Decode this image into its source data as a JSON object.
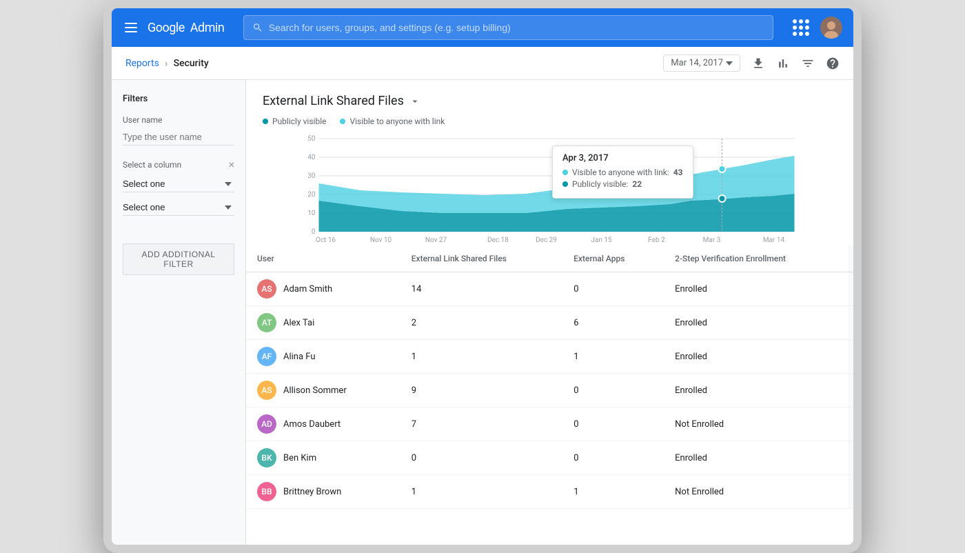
{
  "topbar": {
    "search_placeholder": "Search for users, groups, and settings (e.g. setup billing)",
    "logo_text": "Google",
    "admin_text": "Admin"
  },
  "breadcrumb": {
    "reports": "Reports",
    "security": "Security",
    "date": "Mar 14, 2017"
  },
  "filters": {
    "title": "Filters",
    "username_label": "User name",
    "username_placeholder": "Type the user name",
    "select_column_label": "Select a column",
    "select_one_1": "Select one",
    "select_one_2": "Select one",
    "add_filter_label": "ADD ADDITIONAL FILTER"
  },
  "chart": {
    "title": "External Link Shared Files",
    "legend": [
      {
        "label": "Publicly visible",
        "color": "#0097a7"
      },
      {
        "label": "Visible to anyone with link",
        "color": "#4dd0e1"
      }
    ],
    "x_labels": [
      "Oct 16",
      "Nov 10",
      "Nov 27",
      "Dec 18",
      "Dec 29",
      "Jan 15",
      "Feb 2",
      "Mar 3",
      "Mar 14"
    ],
    "y_labels": [
      "0",
      "10",
      "20",
      "30",
      "40",
      "50"
    ],
    "tooltip": {
      "date": "Apr 3, 2017",
      "visible_with_link_label": "Visible to anyone with link:",
      "visible_with_link_value": "43",
      "publicly_visible_label": "Publicly visible:",
      "publicly_visible_value": "22"
    }
  },
  "table": {
    "columns": [
      "User",
      "External Link Shared Files",
      "External Apps",
      "2-Step Verification Enrollment"
    ],
    "rows": [
      {
        "name": "Adam Smith",
        "shared_files": "14",
        "external_apps": "0",
        "enrollment": "Enrolled",
        "initials": "AS",
        "color": "#e57373"
      },
      {
        "name": "Alex Tai",
        "shared_files": "2",
        "external_apps": "6",
        "enrollment": "Enrolled",
        "initials": "AT",
        "color": "#81c784"
      },
      {
        "name": "Alina Fu",
        "shared_files": "1",
        "external_apps": "1",
        "enrollment": "Enrolled",
        "initials": "AF",
        "color": "#64b5f6"
      },
      {
        "name": "Allison Sommer",
        "shared_files": "9",
        "external_apps": "0",
        "enrollment": "Enrolled",
        "initials": "AS",
        "color": "#ffb74d"
      },
      {
        "name": "Amos Daubert",
        "shared_files": "7",
        "external_apps": "0",
        "enrollment": "Not Enrolled",
        "initials": "AD",
        "color": "#ba68c8"
      },
      {
        "name": "Ben Kim",
        "shared_files": "0",
        "external_apps": "0",
        "enrollment": "Enrolled",
        "initials": "BK",
        "color": "#4db6ac"
      },
      {
        "name": "Brittney Brown",
        "shared_files": "1",
        "external_apps": "1",
        "enrollment": "Not Enrolled",
        "initials": "BB",
        "color": "#f06292"
      }
    ]
  }
}
